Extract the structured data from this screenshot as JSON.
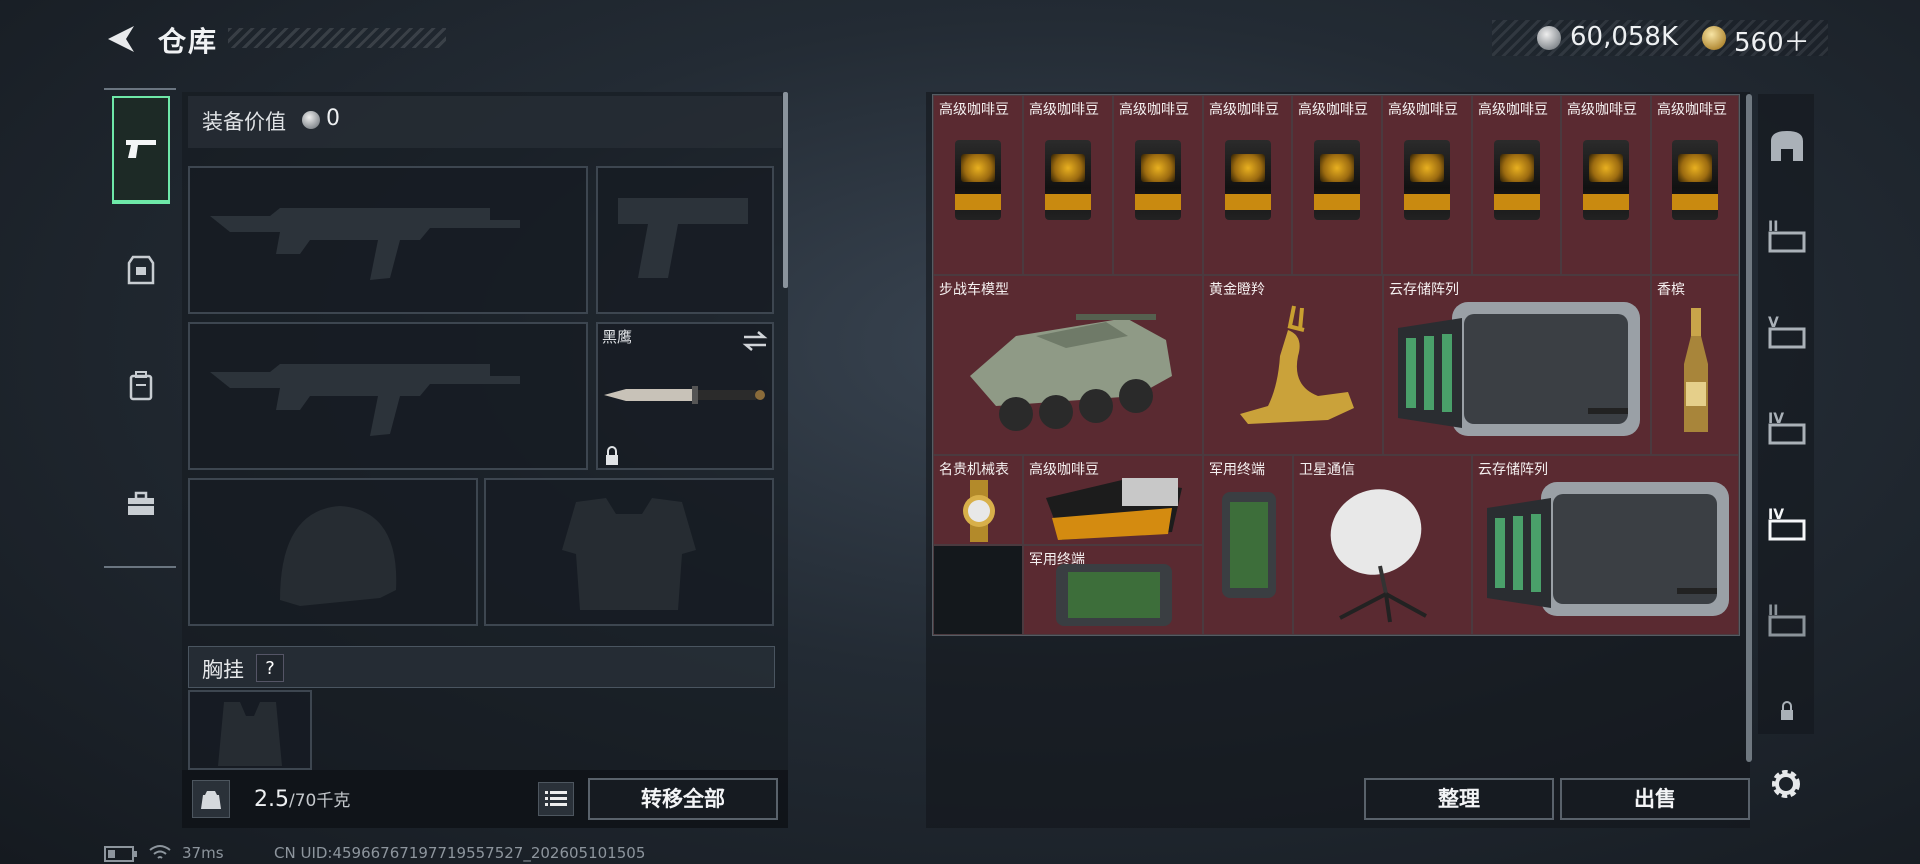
{
  "header": {
    "title": "仓库",
    "currency_silver": "60,058K",
    "currency_gold": "560＋"
  },
  "loadout": {
    "value_label": "装备价值",
    "value": "0",
    "sidearm_slot_label": "黑鹰",
    "chest_label": "胸挂",
    "chest_help": "?",
    "weight_current": "2.5",
    "weight_max": "/70千克",
    "transfer_all": "转移全部"
  },
  "stash": {
    "row1": [
      "高级咖啡豆",
      "高级咖啡豆",
      "高级咖啡豆",
      "高级咖啡豆",
      "高级咖啡豆",
      "高级咖啡豆",
      "高级咖啡豆",
      "高级咖啡豆",
      "高级咖啡豆"
    ],
    "ifv_model": "步战车模型",
    "golden_antelope": "黄金瞪羚",
    "cloud_array_1": "云存储阵列",
    "champagne": "香槟",
    "luxury_watch": "名贵机械表",
    "coffee_bean_open": "高级咖啡豆",
    "military_terminal_1": "军用终端",
    "military_terminal_2": "军用终端",
    "satellite": "卫星通信",
    "cloud_array_2": "云存储阵列",
    "sort_button": "整理",
    "sell_button": "出售"
  },
  "right_tabs": [
    "",
    "II",
    "V",
    "IV",
    "IV",
    "II"
  ],
  "status": {
    "ping": "37ms",
    "uid": "CN UID:459667671977195575​27_202605101505"
  },
  "colors": {
    "accent_green": "#6ee8a8",
    "item_cell_bg": "#5a2a31"
  }
}
